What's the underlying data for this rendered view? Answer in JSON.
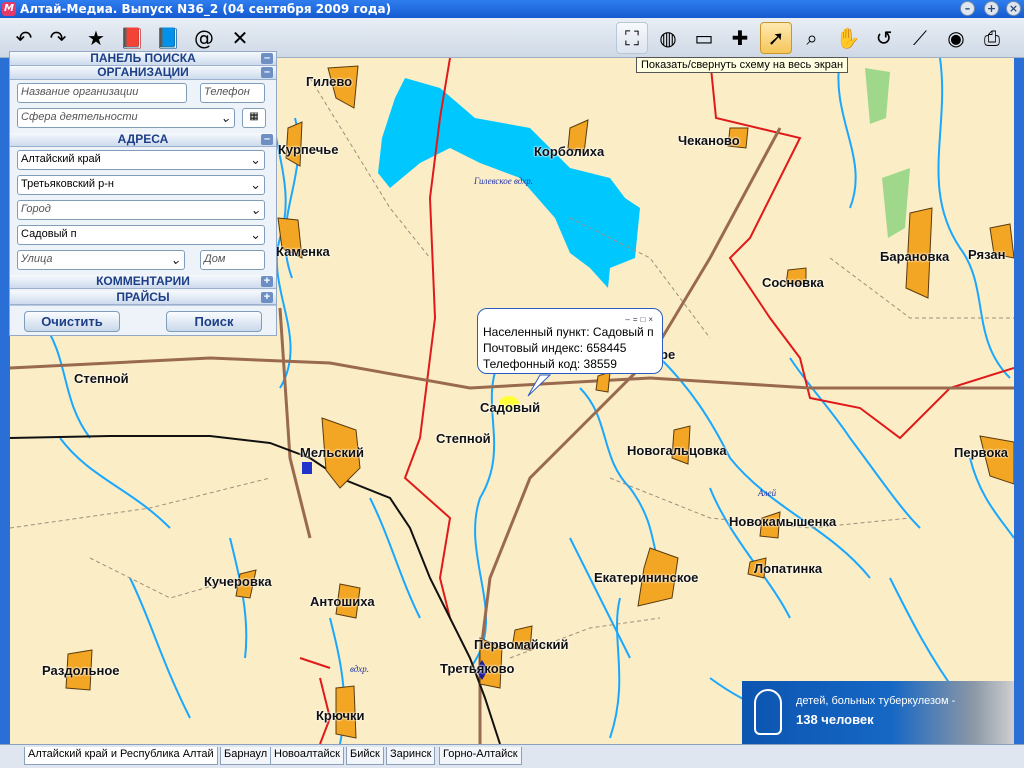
{
  "window": {
    "title": "Алтай-Медиа. Выпуск N36_2 (04 сентября 2009 года)",
    "app_icon": "M"
  },
  "toolbar": {
    "left_icons": [
      "back-icon",
      "forward-icon",
      "bookmark-icon",
      "book-icon",
      "catalog-icon",
      "email-icon",
      "tools-icon"
    ],
    "right_icons": [
      "fullscreen-icon",
      "globe-icon",
      "monitor-icon",
      "layers-icon",
      "pointer-icon",
      "zoom-icon",
      "pan-hand-icon",
      "reset-icon",
      "measure-icon",
      "compass-icon",
      "print-icon"
    ],
    "tooltip": "Показать/свернуть схему на весь экран"
  },
  "search_panel": {
    "title": "ПАНЕЛЬ ПОИСКА",
    "org_section": "ОРГАНИЗАЦИИ",
    "org_name_placeholder": "Название организации",
    "phone_placeholder": "Телефон",
    "activity_placeholder": "Сфера деятельности",
    "address_section": "АДРЕСА",
    "region": "Алтайский край",
    "district": "Третьяковский р-н",
    "city_placeholder": "Город",
    "settlement": "Садовый п",
    "street_placeholder": "Улица",
    "house_placeholder": "Дом",
    "comments_section": "КОММЕНТАРИИ",
    "prices_section": "ПРАЙСЫ",
    "clear_button": "Очистить",
    "search_button": "Поиск"
  },
  "map": {
    "places": [
      {
        "id": "gilevo",
        "label": "Гилево"
      },
      {
        "id": "kurpeche",
        "label": "Курпечье"
      },
      {
        "id": "korbolikha",
        "label": "Корболиха"
      },
      {
        "id": "chekanovo",
        "label": "Чеканово"
      },
      {
        "id": "kamenka",
        "label": "Каменка"
      },
      {
        "id": "baranovka",
        "label": "Барановка"
      },
      {
        "id": "ryazanka",
        "label": "Рязан"
      },
      {
        "id": "sosnovka",
        "label": "Сосновка"
      },
      {
        "id": "stepnoy1",
        "label": "Степной"
      },
      {
        "id": "sadovy",
        "label": "Садовый"
      },
      {
        "id": "stepnoy2",
        "label": "Степной"
      },
      {
        "id": "mesalsky",
        "label": "Мельский"
      },
      {
        "id": "novogaltsovka",
        "label": "Новогальцовка"
      },
      {
        "id": "pervoka",
        "label": "Первока"
      },
      {
        "id": "novokamyshenka",
        "label": "Новокамышенка"
      },
      {
        "id": "kucherovka",
        "label": "Кучеровка"
      },
      {
        "id": "ekaterininskoe",
        "label": "Екатерининское"
      },
      {
        "id": "lopatinka",
        "label": "Лопатинка"
      },
      {
        "id": "antonyikha",
        "label": "Антошиха"
      },
      {
        "id": "pervomaysky",
        "label": "Первомайский"
      },
      {
        "id": "razdolnoe",
        "label": "Раздольное"
      },
      {
        "id": "tretyakovo",
        "label": "Третьяково"
      },
      {
        "id": "kryuchki",
        "label": "Крючки"
      },
      {
        "id": "pe",
        "label": "ре"
      }
    ],
    "water_labels": [
      {
        "id": "gilevskoe",
        "label": "Гилевское вдхр."
      },
      {
        "id": "alei",
        "label": "Алей"
      },
      {
        "id": "vdhr2",
        "label": "вдхр."
      }
    ],
    "popup": {
      "line1": "Населенный пункт: Садовый п",
      "line2": "Почтовый индекс: 658445",
      "line3": "Телефонный код: 38559"
    },
    "ad": {
      "text": "детей, больных туберкулезом -",
      "count": "138 человек"
    }
  },
  "tabs": [
    "Алтайский край и Республика Алтай",
    "Барнаул",
    "Новоалтайск",
    "Бийск",
    "Заринск",
    "Горно-Алтайск"
  ],
  "colors": {
    "land": "#fbeec6",
    "water": "#00c8ff",
    "river": "#1aa7ff",
    "settlement": "#f2a623",
    "border": "#e01a1a",
    "road": "#9a6a50"
  }
}
